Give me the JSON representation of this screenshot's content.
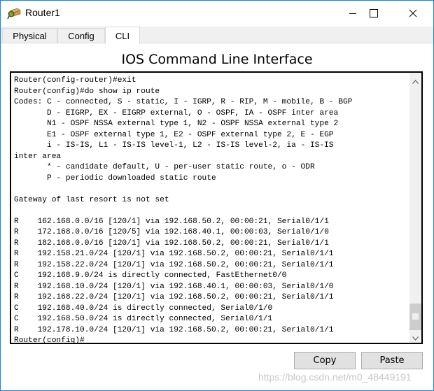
{
  "window": {
    "title": "Router1",
    "icon": "router-icon",
    "controls": {
      "minimize": "minimize-icon",
      "maximize": "maximize-icon",
      "close": "close-icon"
    }
  },
  "tabs": [
    {
      "label": "Physical",
      "active": false
    },
    {
      "label": "Config",
      "active": false
    },
    {
      "label": "CLI",
      "active": true
    }
  ],
  "cli": {
    "heading": "IOS Command Line Interface",
    "lines": [
      "Router(config-router)#exit",
      "Router(config)#do show ip route",
      "Codes: C - connected, S - static, I - IGRP, R - RIP, M - mobile, B - BGP",
      "       D - EIGRP, EX - EIGRP external, O - OSPF, IA - OSPF inter area",
      "       N1 - OSPF NSSA external type 1, N2 - OSPF NSSA external type 2",
      "       E1 - OSPF external type 1, E2 - OSPF external type 2, E - EGP",
      "       i - IS-IS, L1 - IS-IS level-1, L2 - IS-IS level-2, ia - IS-IS",
      "inter area",
      "       * - candidate default, U - per-user static route, o - ODR",
      "       P - periodic downloaded static route",
      "",
      "Gateway of last resort is not set",
      "",
      "R    162.168.0.0/16 [120/1] via 192.168.50.2, 00:00:21, Serial0/1/1",
      "R    172.168.0.0/16 [120/5] via 192.168.40.1, 00:00:03, Serial0/1/0",
      "R    182.168.0.0/16 [120/1] via 192.168.50.2, 00:00:21, Serial0/1/1",
      "R    192.158.21.0/24 [120/1] via 192.168.50.2, 00:00:21, Serial0/1/1",
      "R    192.158.22.0/24 [120/1] via 192.168.50.2, 00:00:21, Serial0/1/1",
      "C    192.168.9.0/24 is directly connected, FastEthernet0/0",
      "R    192.168.10.0/24 [120/1] via 192.168.40.1, 00:00:03, Serial0/1/0",
      "R    192.168.22.0/24 [120/1] via 192.168.50.2, 00:00:21, Serial0/1/1",
      "C    192.168.40.0/24 is directly connected, Serial0/1/0",
      "C    192.168.50.0/24 is directly connected, Serial0/1/1",
      "R    192.178.10.0/24 [120/1] via 192.168.50.2, 00:00:21, Serial0/1/1",
      "Router(config)#"
    ],
    "scroll_position": 0.92
  },
  "buttons": {
    "copy": "Copy",
    "paste": "Paste"
  },
  "watermark": "https://blog.csdn.net/m0_48449191"
}
